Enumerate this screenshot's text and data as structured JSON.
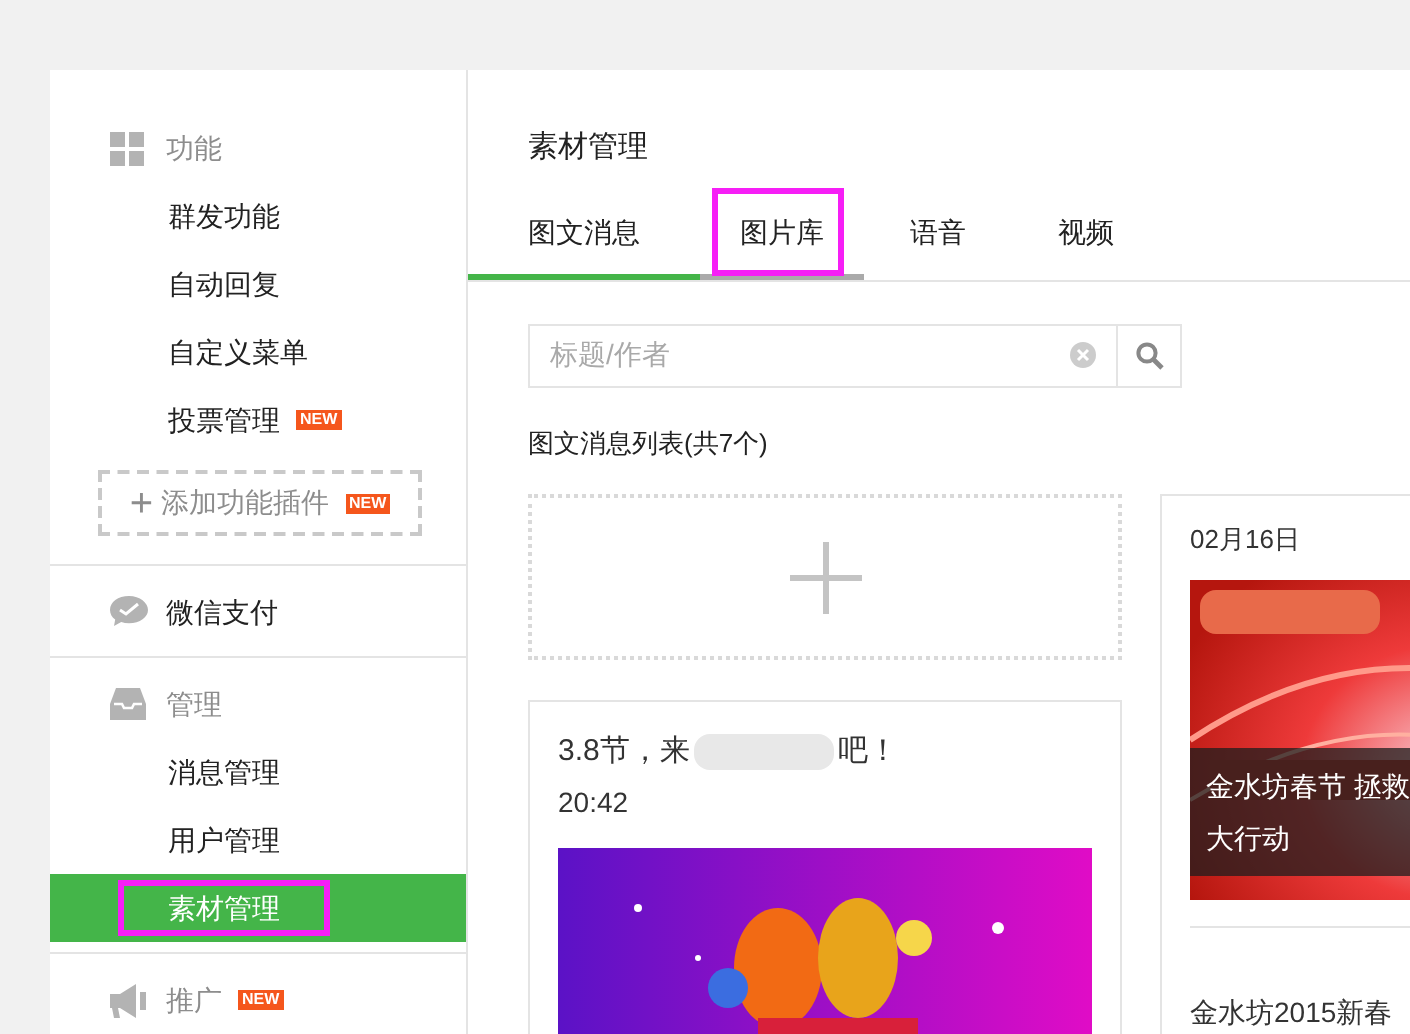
{
  "sidebar": {
    "sections": [
      {
        "kind": "group",
        "label": "功能",
        "items": [
          {
            "label": "群发功能",
            "selected": false,
            "highlighted": false
          },
          {
            "label": "自动回复",
            "selected": false,
            "highlighted": false
          },
          {
            "label": "自定义菜单",
            "selected": false,
            "highlighted": false
          },
          {
            "label": "投票管理",
            "selected": false,
            "highlighted": false,
            "badge": "NEW"
          }
        ],
        "add_button": {
          "icon_text": "+",
          "label": "添加功能插件",
          "badge": "NEW"
        }
      },
      {
        "kind": "link",
        "label": "微信支付"
      },
      {
        "kind": "group",
        "label": "管理",
        "items": [
          {
            "label": "消息管理",
            "selected": false,
            "highlighted": false
          },
          {
            "label": "用户管理",
            "selected": false,
            "highlighted": false
          },
          {
            "label": "素材管理",
            "selected": true,
            "highlighted": true
          }
        ]
      },
      {
        "kind": "group",
        "label": "推广",
        "badge": "NEW"
      }
    ]
  },
  "main": {
    "title": "素材管理",
    "tabs": [
      {
        "label": "图文消息",
        "selected": true,
        "highlighted": false
      },
      {
        "label": "图片库",
        "selected": false,
        "highlighted": true
      },
      {
        "label": "语音",
        "selected": false,
        "highlighted": false
      },
      {
        "label": "视频",
        "selected": false,
        "highlighted": false
      }
    ],
    "search": {
      "placeholder": "标题/作者"
    },
    "list_heading": "图文消息列表(共7个)",
    "cards": [
      {
        "title_start": "3.8节，来",
        "title_end": "吧！",
        "time": "20:42"
      },
      {
        "date": "02月16日",
        "caption_line_1": "金水坊春节 拯救",
        "caption_line_2": "大行动",
        "next_title": "金水坊2015新春"
      }
    ]
  }
}
